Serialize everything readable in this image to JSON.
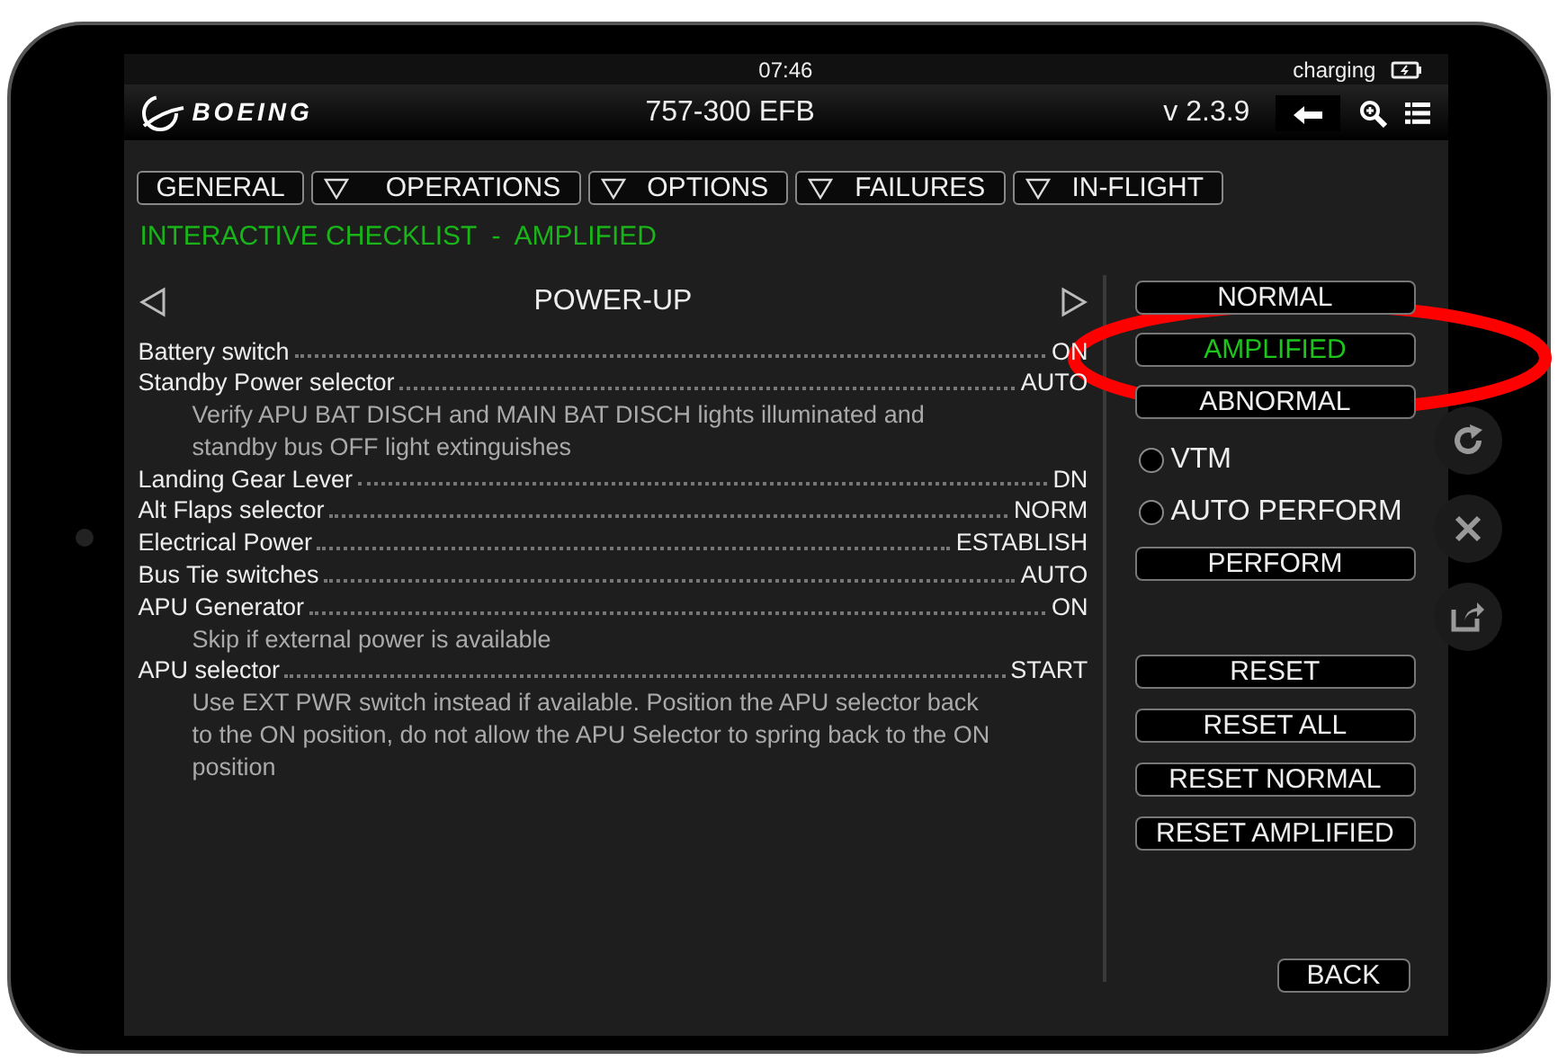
{
  "status_bar": {
    "time": "07:46",
    "charging": "charging"
  },
  "header": {
    "logo": "BOEING",
    "title": "757-300 EFB",
    "version": "v 2.3.9"
  },
  "tabs": [
    {
      "label": "GENERAL",
      "dropdown": false
    },
    {
      "label": "OPERATIONS",
      "dropdown": true
    },
    {
      "label": "OPTIONS",
      "dropdown": true
    },
    {
      "label": "FAILURES",
      "dropdown": true
    },
    {
      "label": "IN-FLIGHT",
      "dropdown": true
    }
  ],
  "heading": "INTERACTIVE CHECKLIST  -  AMPLIFIED",
  "checklist": {
    "title": "POWER-UP",
    "items": [
      {
        "item": "Battery switch",
        "action": "ON"
      },
      {
        "item": "Standby Power selector",
        "action": "AUTO",
        "note": "Verify APU BAT DISCH and MAIN BAT DISCH lights illuminated and standby bus OFF light extinguishes"
      },
      {
        "item": "Landing Gear Lever",
        "action": "DN"
      },
      {
        "item": "Alt Flaps selector",
        "action": "NORM"
      },
      {
        "item": "Electrical Power",
        "action": "ESTABLISH"
      },
      {
        "item": "Bus Tie switches",
        "action": "AUTO"
      },
      {
        "item": "APU Generator",
        "action": "ON",
        "note": "Skip if external power is available"
      },
      {
        "item": "APU selector",
        "action": "START",
        "note": "Use EXT PWR switch instead if available. Position the APU selector back to the ON position, do not allow the APU Selector to spring back to the ON position"
      }
    ]
  },
  "modes": [
    {
      "label": "NORMAL",
      "selected": false
    },
    {
      "label": "AMPLIFIED",
      "selected": true
    },
    {
      "label": "ABNORMAL",
      "selected": false
    }
  ],
  "options": [
    {
      "label": "VTM",
      "checked": false
    },
    {
      "label": "AUTO PERFORM",
      "checked": false
    }
  ],
  "perform": "PERFORM",
  "reset_buttons": [
    "RESET",
    "RESET ALL",
    "RESET NORMAL",
    "RESET AMPLIFIED"
  ],
  "back": "BACK"
}
